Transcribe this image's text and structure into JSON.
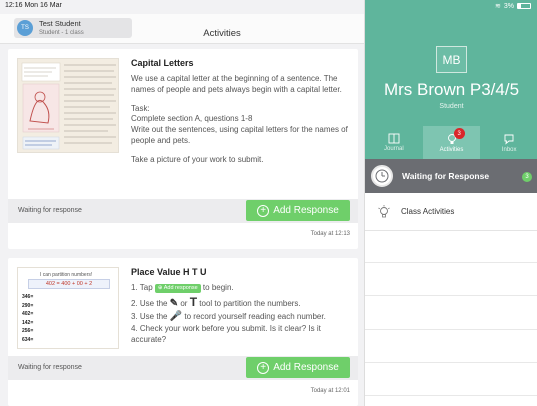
{
  "status_bar": {
    "time": "12:16  Mon 16 Mar",
    "battery": "3%"
  },
  "header": {
    "avatar_initials": "TS",
    "student_name": "Test Student",
    "student_sub": "Student - 1 class",
    "title": "Activities"
  },
  "activities": [
    {
      "title": "Capital Letters",
      "paragraphs": [
        "We use a capital letter at the beginning of a sentence. The names of people and pets always begin with a capital letter.",
        "Task:\nComplete section A, questions 1-8\nWrite out the sentences, using capital letters for the names of people and pets.",
        "Take a picture of your work to submit."
      ],
      "status": "Waiting for response",
      "button": "Add Response",
      "timestamp": "Today at 12:13"
    },
    {
      "title": "Place Value H T U",
      "step1_pre": "1. Tap",
      "step1_btn": "Add response",
      "step1_post": "to begin.",
      "step2_pre": "2. Use the",
      "step2_mid": "or",
      "step2_post": "tool to partition the numbers.",
      "step3_pre": "3. Use the",
      "step3_post": "to record yourself reading each number.",
      "step4": "4. Check your work before you submit. Is it clear? Is it accurate?",
      "thumb_heading": "I can partition numbers!",
      "thumb_eq": "402 = 400 + 00 + 2",
      "thumb_numbers": [
        "346=",
        "290=",
        "402=",
        "142=",
        "256=",
        "634="
      ],
      "status": "Waiting for response",
      "button": "Add Response",
      "timestamp": "Today at 12:01"
    }
  ],
  "sidebar": {
    "initials": "MB",
    "teacher": "Mrs Brown P3/4/5",
    "role": "Student",
    "tabs": [
      {
        "label": "Journal",
        "icon": "book-icon"
      },
      {
        "label": "Activities",
        "icon": "lightbulb-icon",
        "badge": "3"
      },
      {
        "label": "Inbox",
        "icon": "chat-icon"
      }
    ],
    "waiting_label": "Waiting for Response",
    "waiting_count": "3",
    "class_label": "Class Activities"
  },
  "colors": {
    "teal": "#5fb59c",
    "green": "#6fcf6a",
    "badge_red": "#d9262a",
    "row_grey": "#6b6d72"
  }
}
